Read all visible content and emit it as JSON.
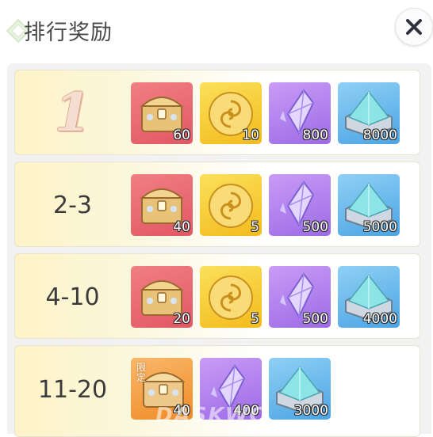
{
  "header": {
    "title": "排行奖励"
  },
  "rows": [
    {
      "rank": "1",
      "rewards": [
        {
          "item": "chest-icon",
          "qty": "60"
        },
        {
          "item": "gold-coin-icon",
          "qty": "10"
        },
        {
          "item": "crystal-icon",
          "qty": "800"
        },
        {
          "item": "ore-box-icon",
          "qty": "8000"
        }
      ]
    },
    {
      "rank": "2-3",
      "rewards": [
        {
          "item": "chest-icon",
          "qty": "40"
        },
        {
          "item": "gold-coin-icon",
          "qty": "5"
        },
        {
          "item": "crystal-icon",
          "qty": "500"
        },
        {
          "item": "ore-box-icon",
          "qty": "5000"
        }
      ]
    },
    {
      "rank": "4-10",
      "rewards": [
        {
          "item": "chest-icon",
          "qty": "20"
        },
        {
          "item": "gold-coin-icon",
          "qty": "5"
        },
        {
          "item": "crystal-icon",
          "qty": "500"
        },
        {
          "item": "ore-box-icon",
          "qty": "4000"
        }
      ]
    },
    {
      "rank": "11-20",
      "rewards": [
        {
          "item": "limited-chest-icon",
          "qty": "40",
          "badge": "限定"
        },
        {
          "item": "crystal-icon",
          "qty": "400"
        },
        {
          "item": "ore-box-icon",
          "qty": "3000"
        }
      ]
    }
  ],
  "watermark": "DASKWC",
  "colors": {
    "red_tile": "#e8656e",
    "gold_tile": "#f6c92c",
    "purple_tile": "#b382ee",
    "blue_tile": "#6cbbee",
    "orange_tile": "#f49d42"
  }
}
